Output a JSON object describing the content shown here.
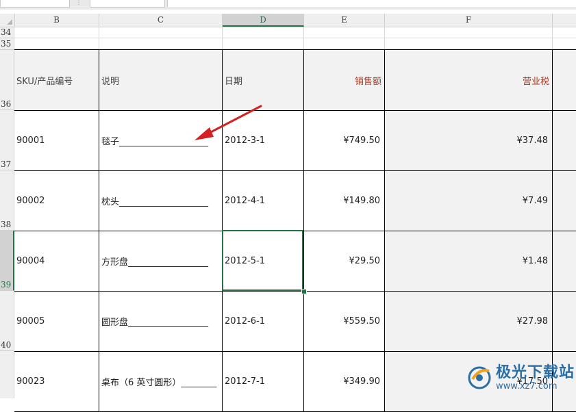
{
  "toolbar": {
    "namebox_value": "",
    "fx_symbol": "⋮"
  },
  "columns": [
    {
      "id": "B",
      "label": "B"
    },
    {
      "id": "C",
      "label": "C"
    },
    {
      "id": "D",
      "label": "D"
    },
    {
      "id": "E",
      "label": "E"
    },
    {
      "id": "F",
      "label": "F"
    }
  ],
  "rows": {
    "r34": "34",
    "r35": "35",
    "r36": "36",
    "r37": "37",
    "r38": "38",
    "r39": "39",
    "r40": "40"
  },
  "table_header": {
    "sku": "SKU/产品编号",
    "desc": "说明",
    "date": "日期",
    "sales": "销售额",
    "tax": "营业税"
  },
  "table_rows": [
    {
      "sku": "90001",
      "desc": "毯子____________________",
      "date": "2012-3-1",
      "sales": "¥749.50",
      "tax": "¥37.48"
    },
    {
      "sku": "90002",
      "desc": "枕头____________________",
      "date": "2012-4-1",
      "sales": "¥149.80",
      "tax": "¥7.49"
    },
    {
      "sku": "90004",
      "desc": "方形盘__________________",
      "date": "2012-5-1",
      "sales": "¥29.50",
      "tax": "¥1.48"
    },
    {
      "sku": "90005",
      "desc": "圆形盘__________________",
      "date": "2012-6-1",
      "sales": "¥559.50",
      "tax": "¥27.98"
    },
    {
      "sku": "90023",
      "desc": "桌布（6 英寸圆形）________",
      "date": "2012-7-1",
      "sales": "¥349.90",
      "tax": "¥17.50"
    }
  ],
  "selection": {
    "cell": "D39"
  },
  "colors": {
    "accent": "#217346",
    "header_red": "#a63c24",
    "arrow": "#d42020"
  },
  "watermark": {
    "title": "极光下载站",
    "url": "www.xz7.com"
  }
}
